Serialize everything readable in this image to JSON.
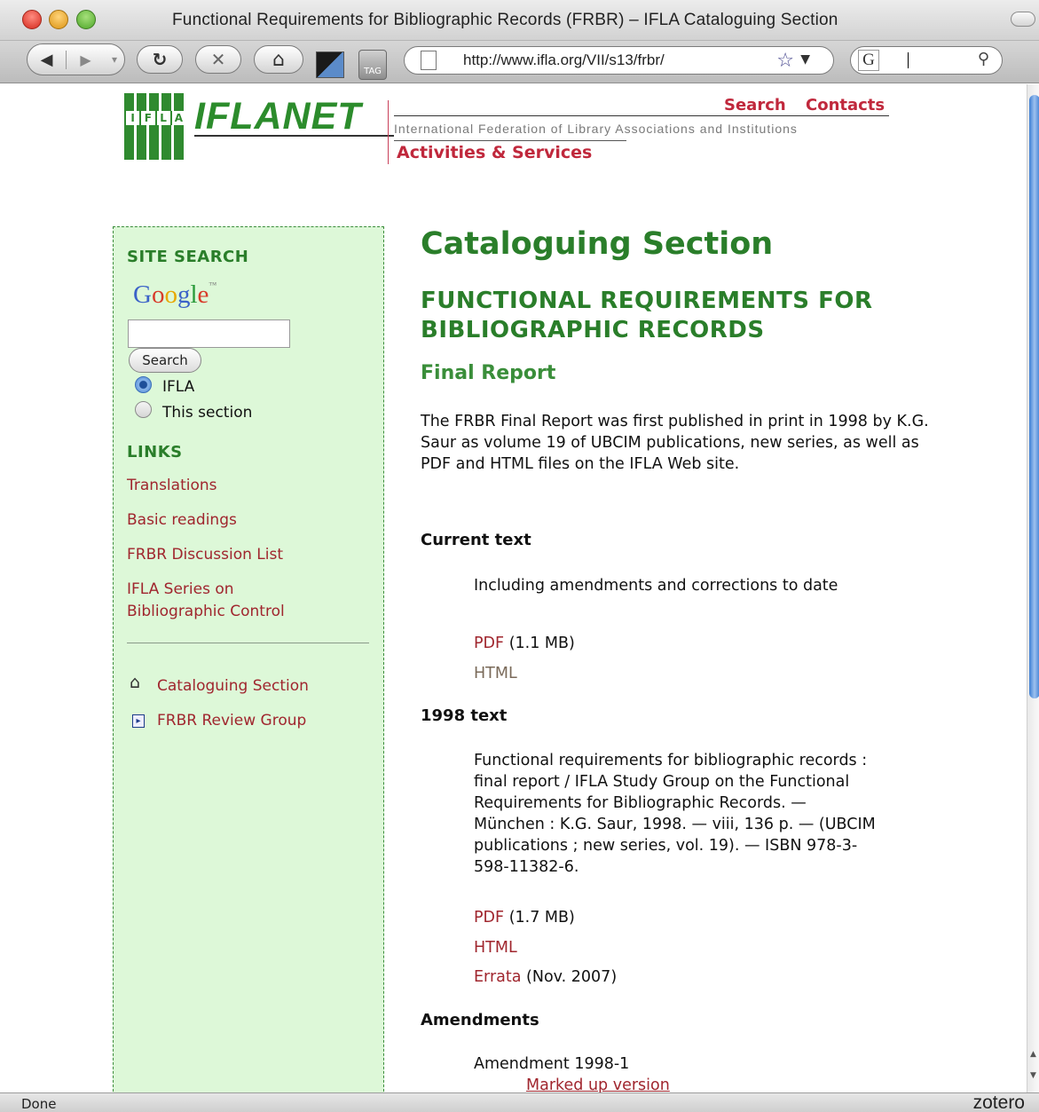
{
  "window": {
    "title": "Functional Requirements for Bibliographic Records (FRBR) – IFLA Cataloguing Section"
  },
  "toolbar": {
    "back_glyph": "◀",
    "forward_glyph": "▶",
    "forward_menu_glyph": "▾",
    "reload_glyph": "↻",
    "stop_glyph": "✕",
    "home_glyph": "⌂",
    "tag_label": "TAG",
    "url": "http://www.ifla.org/VII/s13/frbr/",
    "bookmark_star_glyph": "☆",
    "url_dropdown_glyph": "▼",
    "search_engine_glyph": "G",
    "search_glyph": "⚲"
  },
  "header": {
    "logo_letters": [
      "I",
      "F",
      "L",
      "A"
    ],
    "brand": "IFLANET",
    "link_search": "Search",
    "link_contacts": "Contacts",
    "tagline": "International Federation of Library Associations and Institutions",
    "activities": "Activities & Services"
  },
  "sidebar": {
    "site_search_heading": "SITE SEARCH",
    "google_letters": [
      "G",
      "o",
      "o",
      "g",
      "l",
      "e"
    ],
    "google_tm": "™",
    "search_value": "",
    "search_button": "Search",
    "radio_ifla": "IFLA",
    "radio_section": "This section",
    "links_heading": "LINKS",
    "links": [
      "Translations",
      "Basic readings",
      "FRBR Discussion List",
      "IFLA Series on Bibliographic Control"
    ],
    "home_glyph": "⌂",
    "arrow_glyph": "▸",
    "nav_cataloguing": "Cataloguing Section",
    "nav_review": "FRBR Review Group"
  },
  "main": {
    "title": "Cataloguing Section",
    "subtitle": "FUNCTIONAL REQUIREMENTS FOR BIBLIOGRAPHIC RECORDS",
    "final_report": "Final Report",
    "intro": "The FRBR Final Report was first published in print in 1998 by K.G. Saur as volume 19 of UBCIM publications, new series, as well as PDF and HTML files on the IFLA Web site.",
    "current_heading": "Current text",
    "current_desc": "Including amendments and corrections to date",
    "current_pdf": "PDF",
    "current_pdf_size": "(1.1 MB)",
    "current_html": "HTML",
    "text1998_heading": "1998 text",
    "text1998_desc": "Functional requirements for bibliographic records : final report / IFLA Study Group on the Functional Requirements for Bibliographic Records. — München : K.G. Saur, 1998. — viii, 136 p. — (UBCIM publications ; new series, vol. 19). — ISBN 978-3-598-11382-6.",
    "text1998_pdf": "PDF",
    "text1998_pdf_size": "(1.7 MB)",
    "text1998_html": "HTML",
    "errata": "Errata",
    "errata_date": "(Nov. 2007)",
    "amendments_heading": "Amendments",
    "amendment_1": "Amendment 1998-1",
    "marked_up": "Marked up version"
  },
  "status": {
    "text": "Done",
    "zotero": "zotero"
  },
  "colors": {
    "green_heading": "#2a7e2a",
    "link_red": "#a0262e",
    "sidebar_bg": "#ddf8d8",
    "brand_green": "#2c8c2c"
  }
}
